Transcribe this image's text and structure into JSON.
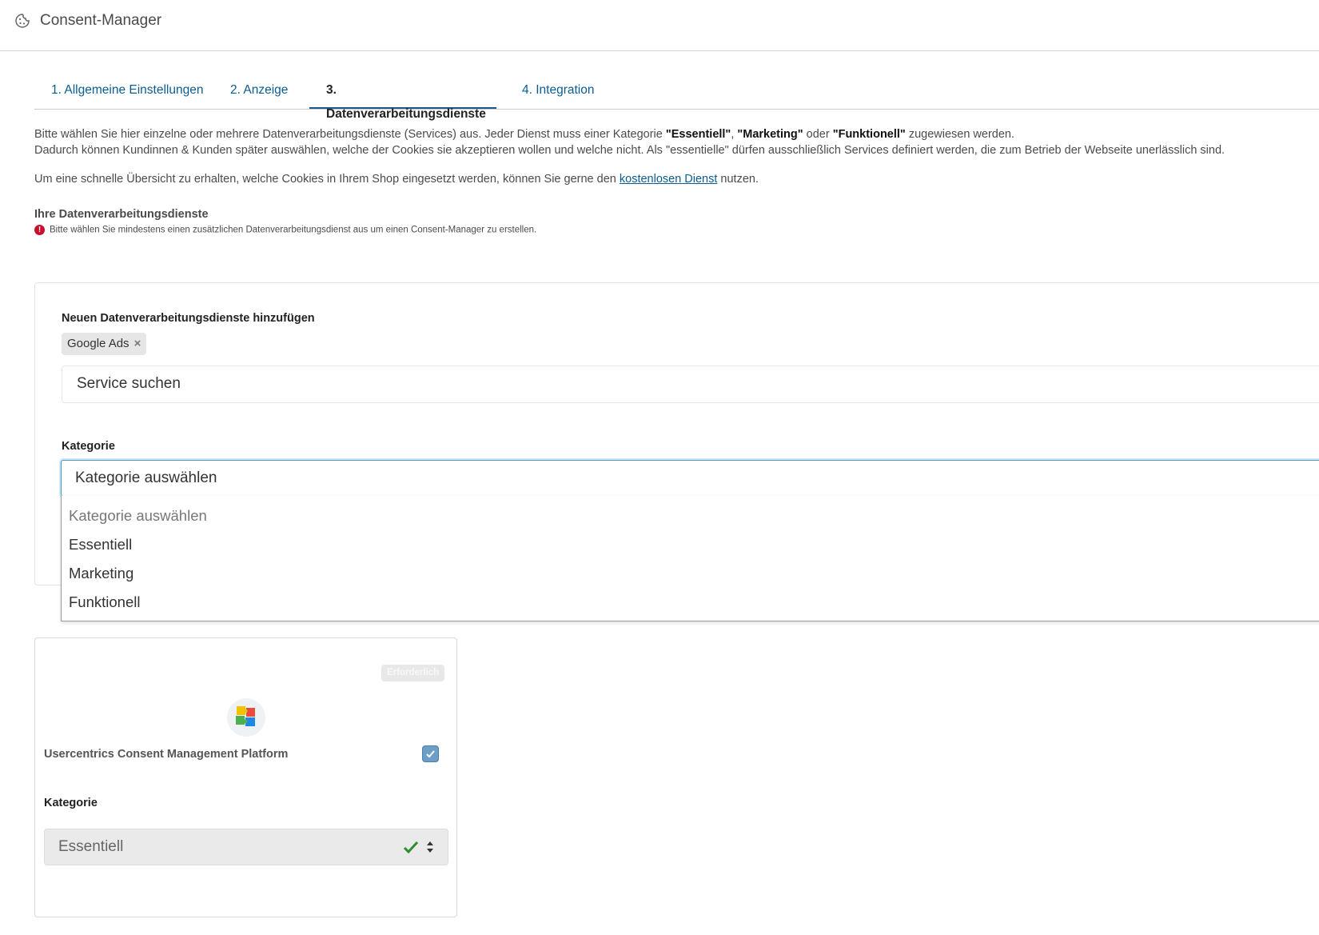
{
  "header": {
    "title": "Consent-Manager",
    "icon": "cookie-icon"
  },
  "tabs": [
    {
      "label": "1. Allgemeine Einstellungen",
      "active": false
    },
    {
      "label": "2. Anzeige",
      "active": false
    },
    {
      "label": "3. Datenverarbeitungsdienste",
      "active": true
    },
    {
      "label": "4. Integration",
      "active": false
    }
  ],
  "intro": {
    "line1_a": "Bitte wählen Sie hier einzelne oder mehrere Datenverarbeitungsdienste (Services) aus. Jeder Dienst muss einer Kategorie ",
    "essentiell": "\"Essentiell\"",
    "sep1": ", ",
    "marketing": "\"Marketing\"",
    "or": " oder ",
    "funktionell": "\"Funktionell\"",
    "line1_b": " zugewiesen werden.",
    "line2": "Dadurch können Kundinnen & Kunden später auswählen, welche der Cookies sie akzeptieren wollen und welche nicht. Als \"essentielle\" dürfen ausschließlich Services definiert werden, die zum Betrieb der Webseite unerlässlich sind.",
    "line3_a": "Um eine schnelle Übersicht zu erhalten, welche Cookies in Ihrem Shop eingesetzt werden, können Sie gerne den ",
    "link": "kostenlosen Dienst",
    "line3_b": " nutzen."
  },
  "services_section": {
    "title": "Ihre Datenverarbeitungsdienste",
    "error_icon": "!",
    "error": "Bitte wählen Sie mindestens einen zusätzlichen Datenverarbeitungsdienst aus um einen Consent-Manager zu erstellen."
  },
  "add_panel": {
    "title": "Neuen Datenverarbeitungsdienste hinzufügen",
    "chip": "Google Ads",
    "chip_remove": "×",
    "search_placeholder": "Service suchen",
    "category_label": "Kategorie",
    "category_value": "Kategorie auswählen",
    "options": [
      "Kategorie auswählen",
      "Essentiell",
      "Marketing",
      "Funktionell"
    ]
  },
  "service_card": {
    "badge": "Erforderlich",
    "logo_icon": "puzzle-icon",
    "name": "Usercentrics Consent Management Platform",
    "checked": true,
    "category_label": "Kategorie",
    "category_value": "Essentiell"
  },
  "colors": {
    "link": "#0b5c91",
    "error": "#c8102e",
    "focus": "#4d97c8",
    "valid": "#2e8b2e"
  }
}
